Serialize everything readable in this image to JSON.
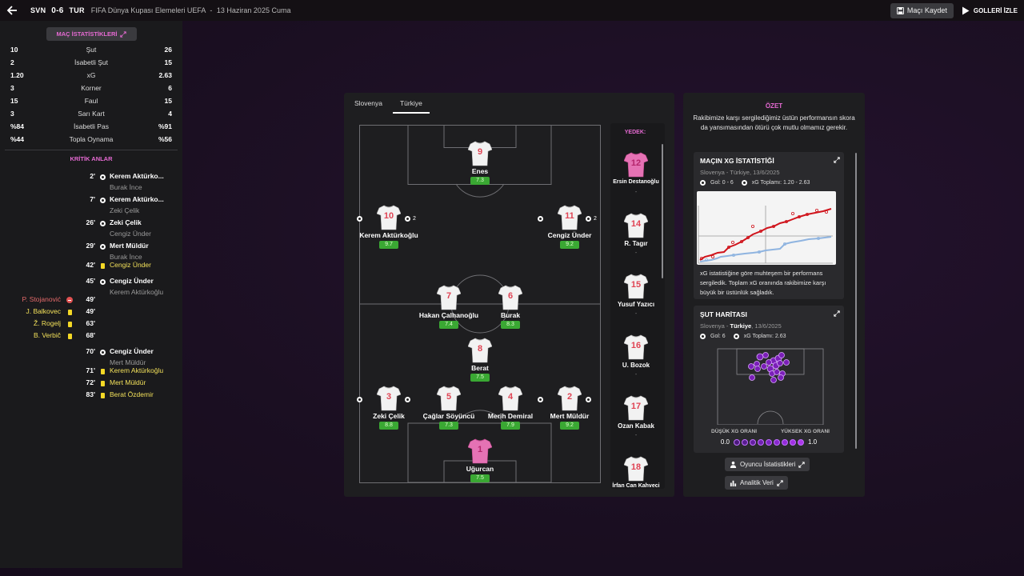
{
  "header": {
    "home_abbr": "SVN",
    "score": "0-6",
    "away_abbr": "TUR",
    "competition": "FIFA Dünya Kupası Elemeleri UEFA",
    "separator": "-",
    "date": "13 Haziran 2025 Cuma",
    "save_label": "Maçı Kaydet",
    "goals_label": "GOLLERİ İZLE"
  },
  "stats": {
    "button_label": "MAÇ İSTATİSTİKLERİ",
    "rows": [
      {
        "home": "10",
        "label": "Şut",
        "away": "26"
      },
      {
        "home": "2",
        "label": "İsabetli Şut",
        "away": "15"
      },
      {
        "home": "1.20",
        "label": "xG",
        "away": "2.63"
      },
      {
        "home": "3",
        "label": "Korner",
        "away": "6"
      },
      {
        "home": "15",
        "label": "Faul",
        "away": "15"
      },
      {
        "home": "3",
        "label": "Sarı Kart",
        "away": "4"
      },
      {
        "home": "%84",
        "label": "İsabetli Pas",
        "away": "%91"
      },
      {
        "home": "%44",
        "label": "Topla Oynama",
        "away": "%56"
      }
    ]
  },
  "key_moments": {
    "title": "KRİTİK ANLAR",
    "away_events": [
      {
        "minute": "2'",
        "type": "goal",
        "player": "Kerem Aktürko...",
        "assist": "Burak İnce"
      },
      {
        "minute": "7'",
        "type": "goal",
        "player": "Kerem Aktürko...",
        "assist": "Zeki Çelik"
      },
      {
        "minute": "26'",
        "type": "goal",
        "player": "Zeki Çelik",
        "assist": "Cengiz Ünder"
      },
      {
        "minute": "29'",
        "type": "goal",
        "player": "Mert Müldür",
        "assist": "Burak İnce"
      },
      {
        "minute": "42'",
        "type": "card",
        "player": "Cengiz Ünder",
        "assist": ""
      },
      {
        "minute": "45'",
        "type": "goal",
        "player": "Cengiz Ünder",
        "assist": "Kerem Aktürkoğlu"
      },
      {
        "minute": "70'",
        "type": "goal",
        "player": "Cengiz Ünder",
        "assist": "Mert Müldür"
      },
      {
        "minute": "71'",
        "type": "card",
        "player": "Kerem Aktürkoğlu",
        "assist": ""
      },
      {
        "minute": "72'",
        "type": "card",
        "player": "Mert Müldür",
        "assist": ""
      },
      {
        "minute": "83'",
        "type": "card",
        "player": "Berat Özdemir",
        "assist": ""
      }
    ],
    "home_events": [
      {
        "minute": "49'",
        "type": "red",
        "player": "P. Stojanović"
      },
      {
        "minute": "49'",
        "type": "card",
        "player": "J. Balkovec"
      },
      {
        "minute": "63'",
        "type": "card",
        "player": "Ž. Rogelj"
      },
      {
        "minute": "68'",
        "type": "card",
        "player": "B. Verbič"
      }
    ]
  },
  "lineup": {
    "tabs": [
      "Slovenya",
      "Türkiye"
    ],
    "active_tab": "Türkiye",
    "players": [
      {
        "number": "9",
        "name": "Enes",
        "rating": "7.3",
        "goals": ""
      },
      {
        "number": "10",
        "name": "Kerem Aktürkoğlu",
        "rating": "9.7",
        "goals": "2"
      },
      {
        "number": "11",
        "name": "Cengiz Ünder",
        "rating": "9.2",
        "goals": "2"
      },
      {
        "number": "7",
        "name": "Hakan Çalhanoğlu",
        "rating": "7.4",
        "goals": ""
      },
      {
        "number": "6",
        "name": "Burak",
        "rating": "8.3",
        "goals": ""
      },
      {
        "number": "8",
        "name": "Berat",
        "rating": "7.5",
        "goals": ""
      },
      {
        "number": "3",
        "name": "Zeki Çelik",
        "rating": "8.8",
        "goals": "1"
      },
      {
        "number": "5",
        "name": "Çağlar Söyüncü",
        "rating": "7.3",
        "goals": ""
      },
      {
        "number": "4",
        "name": "Merih Demiral",
        "rating": "7.9",
        "goals": ""
      },
      {
        "number": "2",
        "name": "Mert Müldür",
        "rating": "9.2",
        "goals": "1"
      },
      {
        "number": "1",
        "name": "Uğurcan",
        "rating": "7.5",
        "goals": ""
      }
    ],
    "bench_title": "YEDEK:",
    "bench": [
      {
        "number": "12",
        "name": "Ersin Destanoğlu",
        "rating": "-",
        "gk": true
      },
      {
        "number": "14",
        "name": "R. Tagır",
        "rating": "-",
        "gk": false
      },
      {
        "number": "15",
        "name": "Yusuf Yazıcı",
        "rating": "-",
        "gk": false
      },
      {
        "number": "16",
        "name": "U. Bozok",
        "rating": "-",
        "gk": false
      },
      {
        "number": "17",
        "name": "Ozan Kabak",
        "rating": "-",
        "gk": false
      },
      {
        "number": "18",
        "name": "İrfan Can Kahveci",
        "rating": "",
        "gk": false
      }
    ]
  },
  "summary": {
    "title": "ÖZET",
    "text": "Rakibimize karşı sergilediğimiz üstün performansın skora da yansımasından ötürü çok mutlu olmamız gerekir.",
    "xg_card": {
      "title": "MAÇIN XG İSTATİSTİĞİ",
      "subtitle": "Slovenya - Türkiye, 13/6/2025",
      "goals": "Gol: 0 - 6",
      "xg_total": "xG Toplamı: 1.20 - 2.63",
      "description": "xG istatistiğine göre muhteşem bir performans sergiledik. Toplam xG oranında rakibimize karşı büyük bir üstünlük sağladık."
    },
    "shot_card": {
      "title": "ŞUT HARİTASI",
      "subtitle_prefix": "Slovenya - ",
      "subtitle_team": "Türkiye",
      "subtitle_suffix": ", 13/6/2025",
      "goals": "Gol: 6",
      "xg_total": "xG Toplamı: 2.63",
      "low_label": "DÜŞÜK XG ORANI",
      "high_label": "YÜKSEK XG ORANI",
      "scale_min": "0.0",
      "scale_max": "1.0"
    },
    "player_stats_label": "Oyuncu İstatistikleri",
    "analytics_label": "Analitik Veri"
  },
  "colors": {
    "accent": "#e56ad2",
    "yellow_card": "#f4d826",
    "rating_green": "#3aa833",
    "turkey_xg": "#d0141c",
    "slovenia_xg": "#8fb4e0"
  }
}
